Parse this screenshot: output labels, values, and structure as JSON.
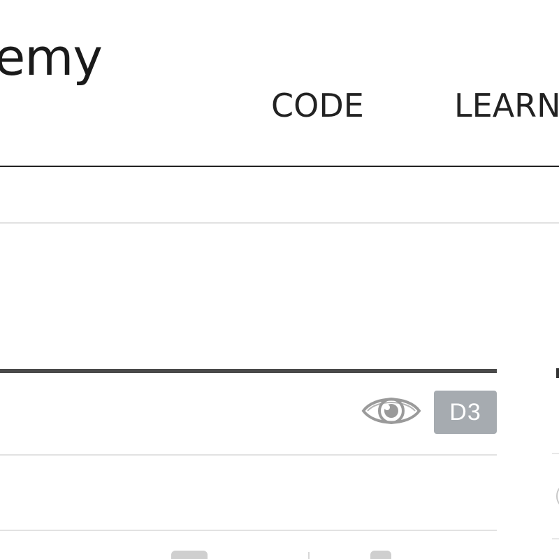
{
  "header": {
    "logo_text": "emy",
    "nav": [
      {
        "label": "CODE"
      },
      {
        "label": "LEARN"
      }
    ]
  },
  "card": {
    "badge_label": "D3",
    "icon": "eye-icon"
  },
  "colors": {
    "nav_text": "#222222",
    "card_border": "#4a4a4a",
    "badge_bg": "#a6abb0",
    "icon_gray": "#9a9a9a"
  }
}
